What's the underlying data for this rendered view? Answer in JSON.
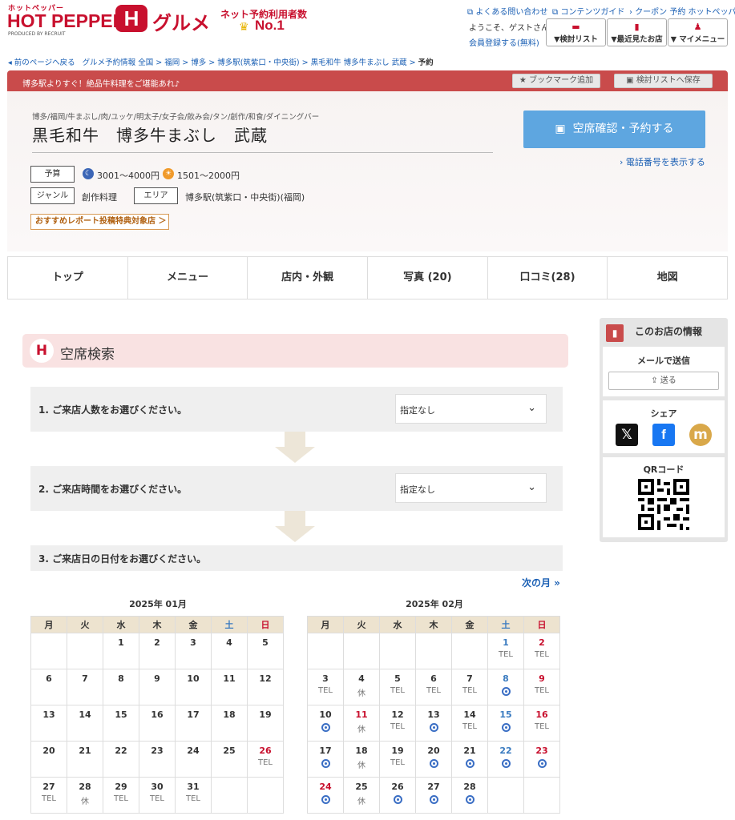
{
  "header": {
    "logo_small": "ホットペッパー",
    "logo_main": "HOT PEPPER",
    "logo_produced": "PRODUCED BY RECRUIT",
    "logo_gourmet": "グルメ",
    "rank_text": "ネット予約利用者数",
    "rank_no1": "No.1",
    "links": [
      "よくある問い合わせ",
      "コンテンツガイド",
      "クーポン 予約 ホットペッパー"
    ],
    "welcome": "ようこそ、ゲストさん",
    "register": "会員登録する(無料)",
    "buttons": [
      "▼検討リスト",
      "▼最近見たお店",
      "▼ マイメニュー"
    ]
  },
  "breadcrumb": {
    "back": "前のページへ戻る",
    "path": "グルメ予約情報 全国 > 福岡 > 博多 > 博多駅(筑紫口・中央街) > 黒毛和牛 博多牛まぶし 武蔵 >",
    "current": "予約"
  },
  "banner": {
    "text": "博多駅よりすぐ！絶品牛料理をご堪能あれ♪",
    "bookmark": "ブックマーク追加",
    "save": "検討リストへ保存"
  },
  "shop": {
    "categories": "博多/福岡/牛まぶし/肉/ユッケ/明太子/女子会/飲み会/タン/創作/和食/ダイニングバー",
    "name": "黒毛和牛　博多牛まぶし　武蔵",
    "budget_label": "予算",
    "budget_dinner": "3001～4000円",
    "budget_lunch": "1501～2000円",
    "genre_label": "ジャンル",
    "genre": "創作料理",
    "area_label": "エリア",
    "area": "博多駅(筑紫口・中央街)(福岡)",
    "report": "おすすめレポート投稿特典対象店 ＞",
    "reserve": "空席確認・予約する",
    "tel": "› 電話番号を表示する"
  },
  "tabs": [
    "トップ",
    "メニュー",
    "店内・外観",
    "写真 (20)",
    "口コミ(28)",
    "地図"
  ],
  "search": {
    "title": "空席検索",
    "step1": "1. ご来店人数をお選びください。",
    "step2": "2. ご来店時間をお選びください。",
    "step3": "3. ご来店日の日付をお選びください。",
    "select1": "指定なし",
    "select2": "指定なし",
    "next_month": "次の月 »"
  },
  "weekdays": [
    "月",
    "火",
    "水",
    "木",
    "金",
    "土",
    "日"
  ],
  "calendar": [
    {
      "title": "2025年 01月",
      "weeks": [
        [
          [
            "",
            ""
          ],
          [
            "",
            ""
          ],
          [
            "1",
            ""
          ],
          [
            "2",
            ""
          ],
          [
            "3",
            ""
          ],
          [
            "4",
            ""
          ],
          [
            "5",
            ""
          ]
        ],
        [
          [
            "6",
            ""
          ],
          [
            "7",
            ""
          ],
          [
            "8",
            ""
          ],
          [
            "9",
            ""
          ],
          [
            "10",
            ""
          ],
          [
            "11",
            ""
          ],
          [
            "12",
            ""
          ]
        ],
        [
          [
            "13",
            ""
          ],
          [
            "14",
            ""
          ],
          [
            "15",
            ""
          ],
          [
            "16",
            ""
          ],
          [
            "17",
            ""
          ],
          [
            "18",
            ""
          ],
          [
            "19",
            ""
          ]
        ],
        [
          [
            "20",
            ""
          ],
          [
            "21",
            ""
          ],
          [
            "22",
            ""
          ],
          [
            "23",
            ""
          ],
          [
            "24",
            ""
          ],
          [
            "25",
            ""
          ],
          [
            "26",
            "TEL",
            "su"
          ]
        ],
        [
          [
            "27",
            "TEL"
          ],
          [
            "28",
            "休"
          ],
          [
            "29",
            "TEL"
          ],
          [
            "30",
            "TEL"
          ],
          [
            "31",
            "TEL"
          ],
          [
            "",
            ""
          ],
          [
            "",
            ""
          ]
        ]
      ]
    },
    {
      "title": "2025年 02月",
      "weeks": [
        [
          [
            "",
            ""
          ],
          [
            "",
            ""
          ],
          [
            "",
            ""
          ],
          [
            "",
            ""
          ],
          [
            "",
            ""
          ],
          [
            "1",
            "TEL",
            "sa"
          ],
          [
            "2",
            "TEL",
            "su"
          ]
        ],
        [
          [
            "3",
            "TEL"
          ],
          [
            "4",
            "休"
          ],
          [
            "5",
            "TEL"
          ],
          [
            "6",
            "TEL"
          ],
          [
            "7",
            "TEL"
          ],
          [
            "8",
            "ok",
            "sa"
          ],
          [
            "9",
            "TEL",
            "su"
          ]
        ],
        [
          [
            "10",
            "ok"
          ],
          [
            "11",
            "休",
            "su"
          ],
          [
            "12",
            "TEL"
          ],
          [
            "13",
            "ok"
          ],
          [
            "14",
            "TEL"
          ],
          [
            "15",
            "ok",
            "sa"
          ],
          [
            "16",
            "TEL",
            "su"
          ]
        ],
        [
          [
            "17",
            "ok"
          ],
          [
            "18",
            "休"
          ],
          [
            "19",
            "TEL"
          ],
          [
            "20",
            "ok"
          ],
          [
            "21",
            "ok"
          ],
          [
            "22",
            "ok",
            "sa"
          ],
          [
            "23",
            "ok",
            "su"
          ]
        ],
        [
          [
            "24",
            "ok",
            "su"
          ],
          [
            "25",
            "休"
          ],
          [
            "26",
            "ok"
          ],
          [
            "27",
            "ok"
          ],
          [
            "28",
            "ok"
          ],
          [
            "",
            ""
          ],
          [
            "",
            ""
          ]
        ]
      ]
    }
  ],
  "sidebar": {
    "title": "このお店の情報",
    "mail": "メールで送信",
    "send": "送る",
    "share": "シェア",
    "qr": "QRコード"
  }
}
